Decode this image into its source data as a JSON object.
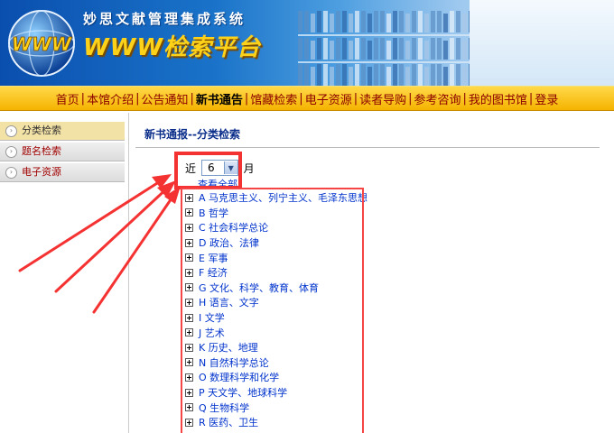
{
  "banner": {
    "title_small": "妙思文献管理集成系统",
    "title_big": "WWW检索平台",
    "logo_text": "WWW"
  },
  "nav": {
    "items": [
      {
        "label": "首页",
        "active": false
      },
      {
        "label": "本馆介绍",
        "active": false
      },
      {
        "label": "公告通知",
        "active": false
      },
      {
        "label": "新书通告",
        "active": true
      },
      {
        "label": "馆藏检索",
        "active": false
      },
      {
        "label": "电子资源",
        "active": false
      },
      {
        "label": "读者导购",
        "active": false
      },
      {
        "label": "参考咨询",
        "active": false
      },
      {
        "label": "我的图书馆",
        "active": false
      },
      {
        "label": "登录",
        "active": false
      }
    ],
    "separator": "|"
  },
  "sidebar": {
    "items": [
      {
        "label": "分类检索",
        "active": true
      },
      {
        "label": "题名检索",
        "active": false
      },
      {
        "label": "电子资源",
        "active": false
      }
    ]
  },
  "main": {
    "heading": "新书通报--分类检索",
    "month_prefix": "近",
    "month_value": "6",
    "month_suffix": "月",
    "view_all": "查看全部",
    "categories": [
      "A 马克思主义、列宁主义、毛泽东思想",
      "B 哲学",
      "C 社会科学总论",
      "D 政治、法律",
      "E 军事",
      "F 经济",
      "G 文化、科学、教育、体育",
      "H 语言、文字",
      "I 文学",
      "J 艺术",
      "K 历史、地理",
      "N 自然科学总论",
      "O 数理科学和化学",
      "P 天文学、地球科学",
      "Q 生物科学",
      "R 医药、卫生"
    ]
  },
  "colors": {
    "nav_bg": "#f5b300",
    "nav_text": "#8a0000",
    "link": "#0033cc",
    "annotation_red": "#f53232"
  }
}
